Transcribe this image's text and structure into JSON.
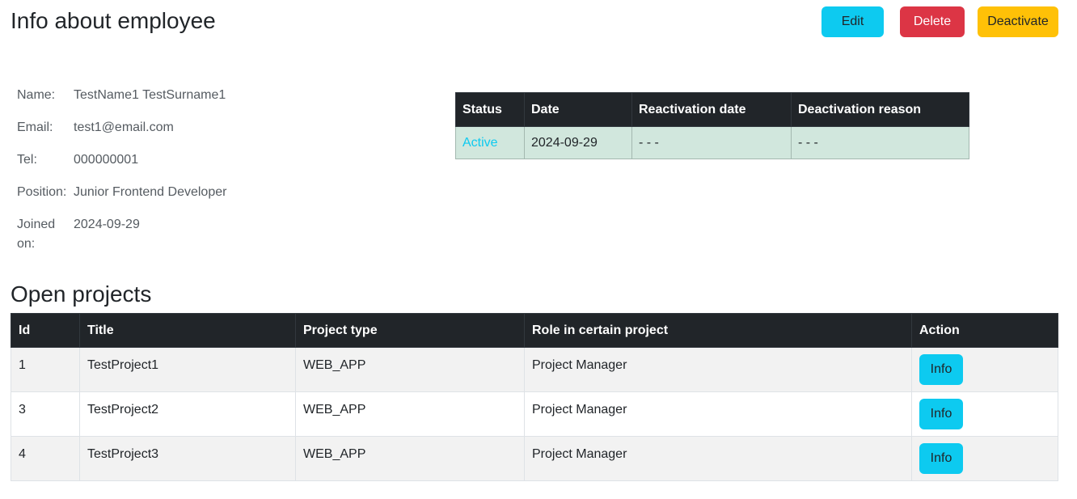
{
  "page": {
    "title": "Info about employee",
    "buttons": {
      "edit": "Edit",
      "delete": "Delete",
      "deactivate": "Deactivate"
    }
  },
  "employee": {
    "fields": [
      {
        "label": "Name:",
        "value": "TestName1 TestSurname1"
      },
      {
        "label": "Email:",
        "value": "test1@email.com"
      },
      {
        "label": "Tel:",
        "value": "000000001"
      },
      {
        "label": "Position:",
        "value": "Junior Frontend Developer"
      },
      {
        "label": "Joined on:",
        "value": "2024-09-29"
      }
    ]
  },
  "status_table": {
    "headers": [
      "Status",
      "Date",
      "Reactivation date",
      "Deactivation reason"
    ],
    "row": [
      "Active",
      "2024-09-29",
      "- - -",
      "- - -"
    ]
  },
  "projects": {
    "title": "Open projects",
    "headers": [
      "Id",
      "Title",
      "Project type",
      "Role in certain project",
      "Action"
    ],
    "rows": [
      {
        "id": "1",
        "title": "TestProject1",
        "type": "WEB_APP",
        "role": "Project Manager",
        "action": "Info"
      },
      {
        "id": "3",
        "title": "TestProject2",
        "type": "WEB_APP",
        "role": "Project Manager",
        "action": "Info"
      },
      {
        "id": "4",
        "title": "TestProject3",
        "type": "WEB_APP",
        "role": "Project Manager",
        "action": "Info"
      }
    ]
  },
  "colors": {
    "primary_info": "#0dcaf0",
    "danger": "#dc3545",
    "warning": "#ffc107",
    "dark_header": "#212529",
    "success_row": "#d1e7dd"
  }
}
